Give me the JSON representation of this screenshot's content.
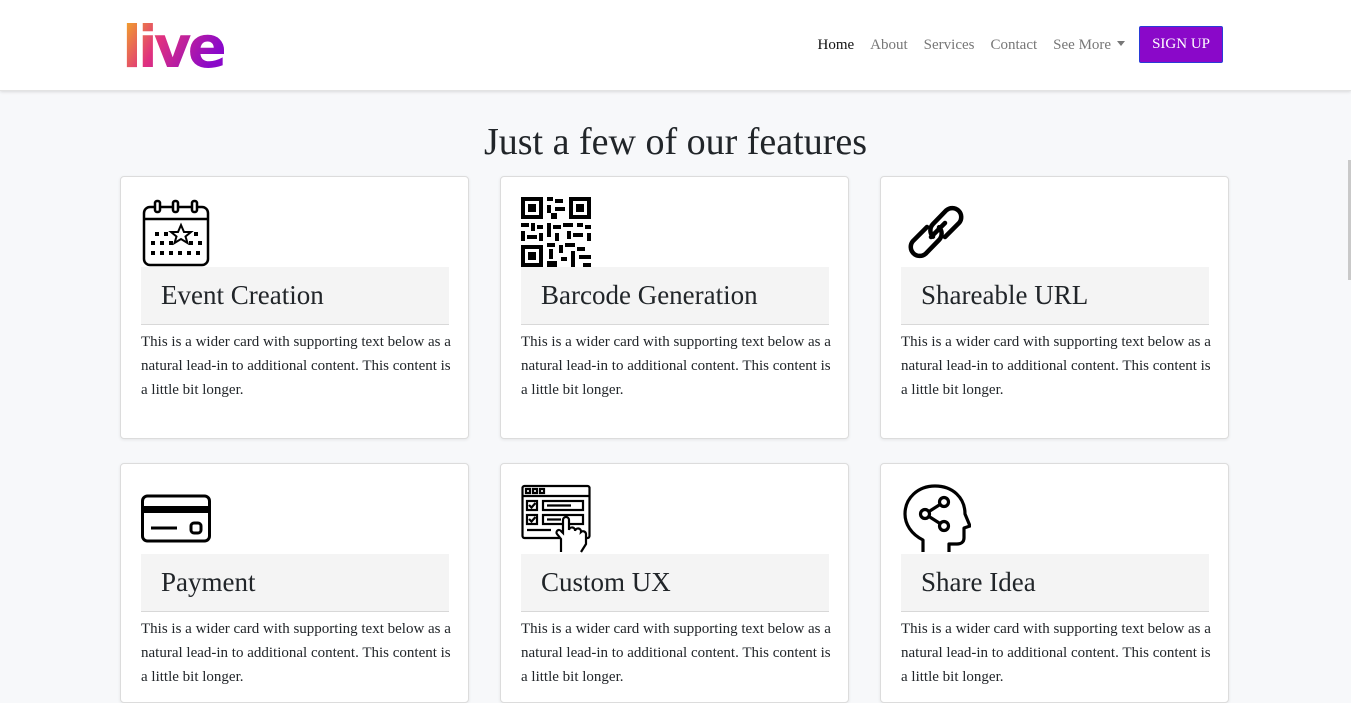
{
  "brand": {
    "logo_text": "live"
  },
  "nav": {
    "items": [
      {
        "label": "Home",
        "active": true
      },
      {
        "label": "About"
      },
      {
        "label": "Services"
      },
      {
        "label": "Contact"
      },
      {
        "label": "See More",
        "dropdown": true
      }
    ],
    "signup_label": "SIGN UP"
  },
  "page": {
    "heading": "Just a few of our features"
  },
  "cards": [
    {
      "icon": "calendar-star-icon",
      "title": "Event Creation",
      "text": "This is a wider card with supporting text below as a natural lead-in to additional content. This content is a little bit longer."
    },
    {
      "icon": "qr-code-icon",
      "title": "Barcode Generation",
      "text": "This is a wider card with supporting text below as a natural lead-in to additional content. This content is a little bit longer."
    },
    {
      "icon": "chain-link-icon",
      "title": "Shareable URL",
      "text": "This is a wider card with supporting text below as a natural lead-in to additional content. This content is a little bit longer."
    },
    {
      "icon": "credit-card-icon",
      "title": "Payment",
      "text": "This is a wider card with supporting text below as a natural lead-in to additional content. This content is a little bit longer."
    },
    {
      "icon": "web-interface-click-icon",
      "title": "Custom UX",
      "text": "This is a wider card with supporting text below as a natural lead-in to additional content. This content is a little bit longer."
    },
    {
      "icon": "head-share-icon",
      "title": "Share Idea",
      "text": "This is a wider card with supporting text below as a natural lead-in to additional content. This content is a little bit longer."
    }
  ],
  "colors": {
    "signup_bg": "#8a08c9",
    "logo_gradient": [
      "#f4b81a",
      "#e0317f",
      "#8a08c9"
    ]
  }
}
